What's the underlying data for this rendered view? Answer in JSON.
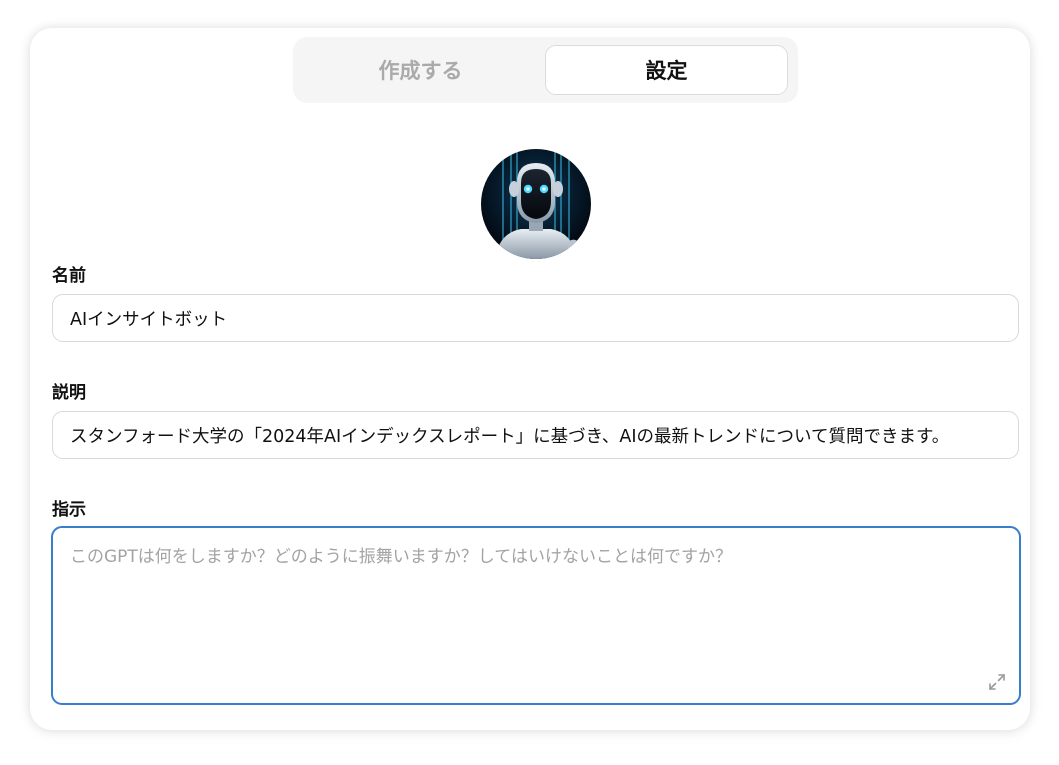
{
  "tabs": [
    {
      "label": "作成する",
      "active": false
    },
    {
      "label": "設定",
      "active": true
    }
  ],
  "avatar": {
    "icon": "robot-avatar"
  },
  "name": {
    "label": "名前",
    "value": "AIインサイトボット"
  },
  "description": {
    "label": "説明",
    "value": "スタンフォード大学の「2024年AIインデックスレポート」に基づき、AIの最新トレンドについて質問できます。"
  },
  "instructions": {
    "label": "指示",
    "value": "",
    "placeholder": "このGPTは何をしますか？どのように振舞いますか？してはいけないことは何ですか？"
  },
  "colors": {
    "focus_border": "#3a7ecb",
    "placeholder": "#a3a3a3",
    "inactive_tab": "#aaaaaa"
  }
}
